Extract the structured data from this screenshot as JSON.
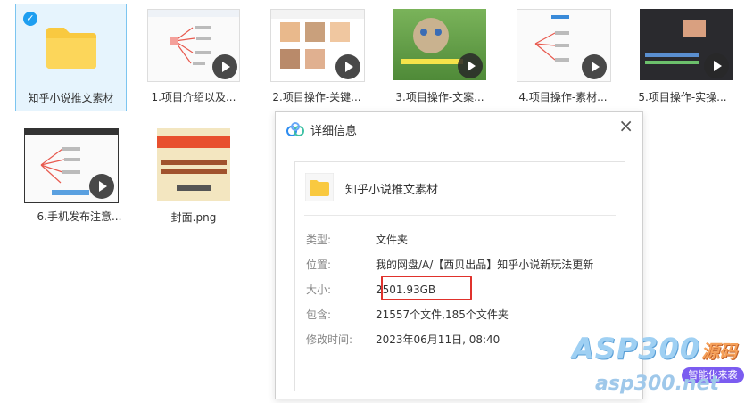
{
  "files": [
    {
      "label": "知乎小说推文素材",
      "type": "folder",
      "selected": true
    },
    {
      "label": "1.项目介绍以及...",
      "type": "video"
    },
    {
      "label": "2.项目操作-关键...",
      "type": "video"
    },
    {
      "label": "3.项目操作-文案...",
      "type": "video"
    },
    {
      "label": "4.项目操作-素材...",
      "type": "video"
    },
    {
      "label": "5.项目操作-实操...",
      "type": "video"
    },
    {
      "label": "6.手机发布注意...",
      "type": "video"
    },
    {
      "label": "封面.png",
      "type": "image"
    }
  ],
  "dialog": {
    "title": "详细信息",
    "folder_name": "知乎小说推文素材",
    "fields": {
      "type_key": "类型:",
      "type_val": "文件夹",
      "location_key": "位置:",
      "location_val": "我的网盘/A/【西贝出品】知乎小说新玩法更新",
      "size_key": "大小:",
      "size_val": "2501.93GB",
      "contains_key": "包含:",
      "contains_val": "21557个文件,185个文件夹",
      "modified_key": "修改时间:",
      "modified_val": "2023年06月11日, 08:40"
    }
  },
  "watermark": {
    "brand": "ASP300",
    "brand_suffix": "源码",
    "badge": "智能化来袭",
    "domain": "asp300.net"
  },
  "colors": {
    "accent": "#1e9ef0",
    "folder": "#f9c940",
    "highlight": "#e0322c"
  }
}
